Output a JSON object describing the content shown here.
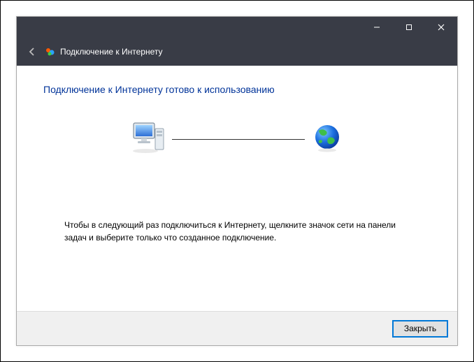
{
  "titlebar": {
    "minimize_tip": "Свернуть",
    "maximize_tip": "Развернуть",
    "close_tip": "Закрыть"
  },
  "header": {
    "back_tip": "Назад",
    "title": "Подключение к Интернету"
  },
  "content": {
    "heading": "Подключение к Интернету готово к использованию",
    "hint": "Чтобы в следующий раз подключиться к Интернету, щелкните значок сети на панели задач и выберите только что созданное подключение."
  },
  "footer": {
    "close_label": "Закрыть"
  },
  "icons": {
    "computer": "computer-icon",
    "globe": "globe-icon"
  }
}
